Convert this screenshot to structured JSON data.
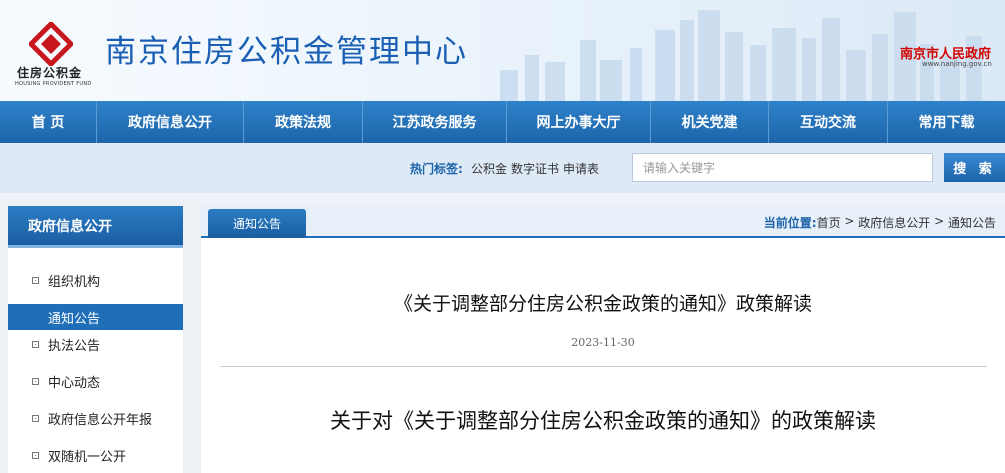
{
  "header": {
    "logo_cn": "住房公积金",
    "logo_en": "HOUSING PROVIDENT FUND",
    "title": "南京住房公积金管理中心",
    "gov_name": "南京市人民政府",
    "gov_url": "www.nanjing.gov.cn"
  },
  "nav": {
    "items": [
      "首 页",
      "政府信息公开",
      "政策法规",
      "江苏政务服务",
      "网上办事大厅",
      "机关党建",
      "互动交流",
      "常用下载"
    ]
  },
  "search": {
    "hot_label": "热门标签:",
    "hot_tags": [
      "公积金",
      "数字证书",
      "申请表"
    ],
    "placeholder": "请输入关键字",
    "button": "搜 索"
  },
  "sidebar": {
    "title": "政府信息公开",
    "items": [
      {
        "label": "组织机构",
        "active": false
      },
      {
        "label": "通知公告",
        "active": true
      },
      {
        "label": "执法公告",
        "active": false
      },
      {
        "label": "中心动态",
        "active": false
      },
      {
        "label": "政府信息公开年报",
        "active": false
      },
      {
        "label": "双随机一公开",
        "active": false
      }
    ]
  },
  "main": {
    "tab": "通知公告",
    "breadcrumb": {
      "label": "当前位置:",
      "parts": [
        "首页",
        "政府信息公开",
        "通知公告"
      ],
      "sep": " > "
    },
    "article_title": "《关于调整部分住房公积金政策的通知》政策解读",
    "date": "2023-11-30",
    "sub_title": "关于对《关于调整部分住房公积金政策的通知》的政策解读"
  },
  "colors": {
    "brand_blue": "#1d64aa",
    "gov_red": "#d40000"
  }
}
